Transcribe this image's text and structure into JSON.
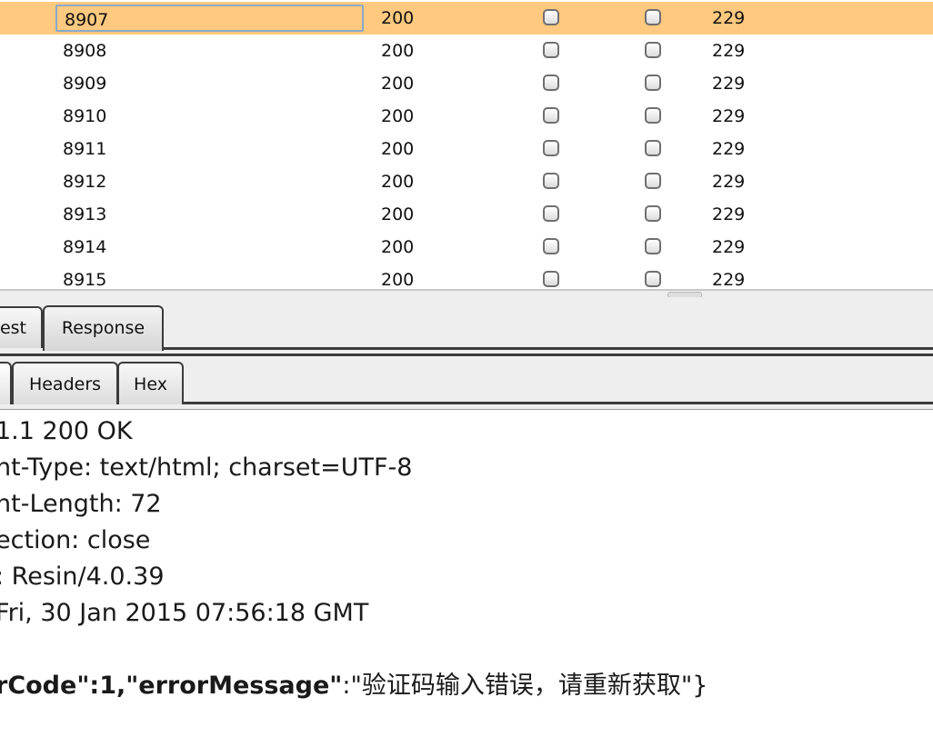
{
  "results": {
    "rows": [
      {
        "payload": "8907",
        "status": "200",
        "error": false,
        "timeout": false,
        "length": "229",
        "selected": true
      },
      {
        "payload": "8908",
        "status": "200",
        "error": false,
        "timeout": false,
        "length": "229"
      },
      {
        "payload": "8909",
        "status": "200",
        "error": false,
        "timeout": false,
        "length": "229"
      },
      {
        "payload": "8910",
        "status": "200",
        "error": false,
        "timeout": false,
        "length": "229"
      },
      {
        "payload": "8911",
        "status": "200",
        "error": false,
        "timeout": false,
        "length": "229"
      },
      {
        "payload": "8912",
        "status": "200",
        "error": false,
        "timeout": false,
        "length": "229"
      },
      {
        "payload": "8913",
        "status": "200",
        "error": false,
        "timeout": false,
        "length": "229"
      },
      {
        "payload": "8914",
        "status": "200",
        "error": false,
        "timeout": false,
        "length": "229"
      },
      {
        "payload": "8915",
        "status": "200",
        "error": false,
        "timeout": false,
        "length": "229"
      }
    ],
    "selected_color": "#ffc97f"
  },
  "tabs_top": {
    "request_label": "est",
    "response_label": "Response"
  },
  "tabs_sub": {
    "headers_label": "Headers",
    "hex_label": "Hex"
  },
  "response": {
    "lines": [
      "1.1 200 OK",
      "nt-Type: text/html; charset=UTF-8",
      "nt-Length: 72",
      "ection: close",
      ": Resin/4.0.39",
      "Fri, 30 Jan 2015 07:56:18 GMT",
      ""
    ],
    "body_key1": "rCode\"",
    "body_sep1": ":1,",
    "body_key2": "\"errorMessage\"",
    "body_sep2": ":",
    "body_value": "\"验证码输入错误，请重新获取\"}"
  }
}
